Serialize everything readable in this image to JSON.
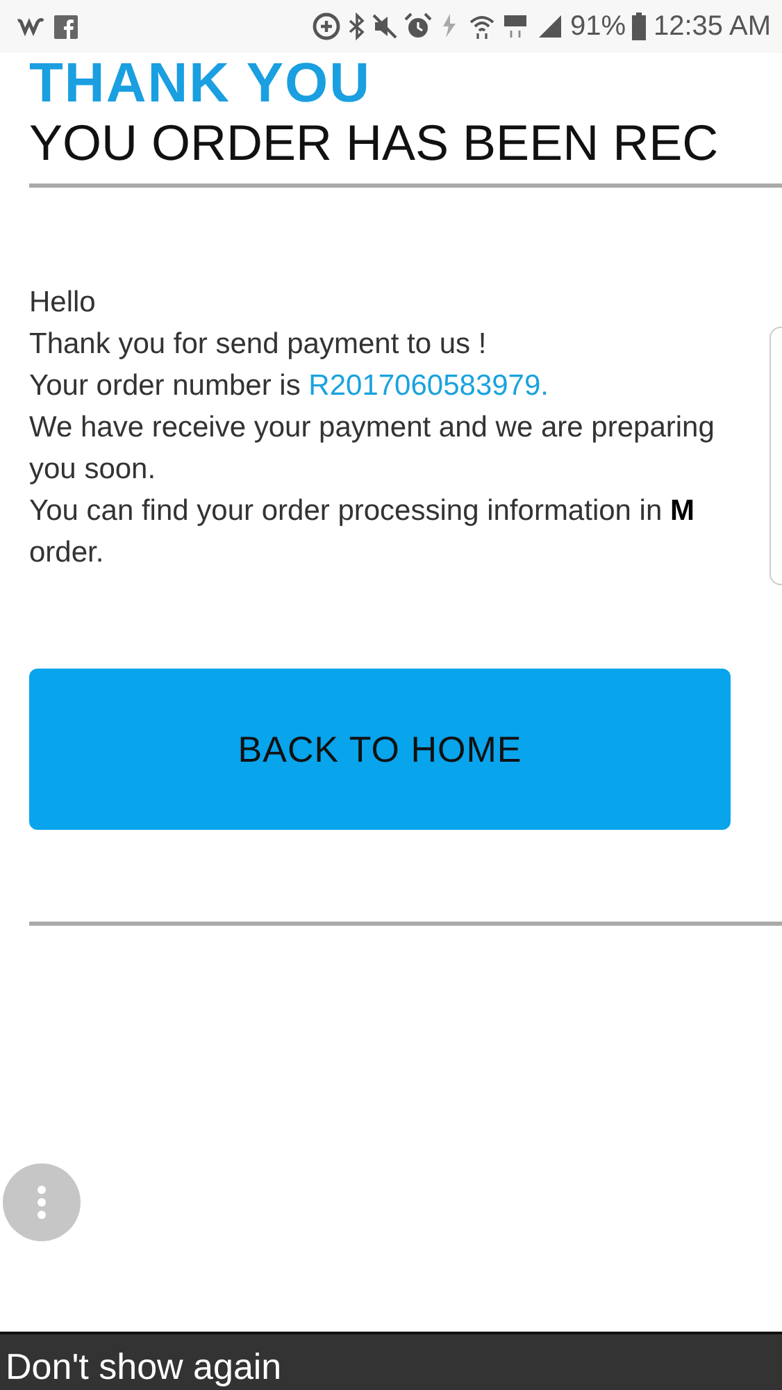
{
  "status_bar": {
    "battery": "91%",
    "time": "12:35 AM"
  },
  "page": {
    "title": "THANK YOU",
    "subtitle": "YOU ORDER HAS BEEN REC",
    "message": [
      {
        "kind": "text",
        "text": "Hello"
      },
      {
        "kind": "text",
        "text": "Thank you for send payment to us !"
      },
      {
        "kind": "order",
        "text": "Your order number is ",
        "link": "R2017060583979."
      },
      {
        "kind": "text",
        "text": "We have receive your payment and we are preparing"
      },
      {
        "kind": "text",
        "text": "you soon."
      },
      {
        "kind": "text",
        "text": "You can find your order processing information in **M**"
      },
      {
        "kind": "text",
        "text": "order."
      }
    ],
    "button": "BACK TO HOME"
  },
  "banner": {
    "text": "Don't show again"
  }
}
